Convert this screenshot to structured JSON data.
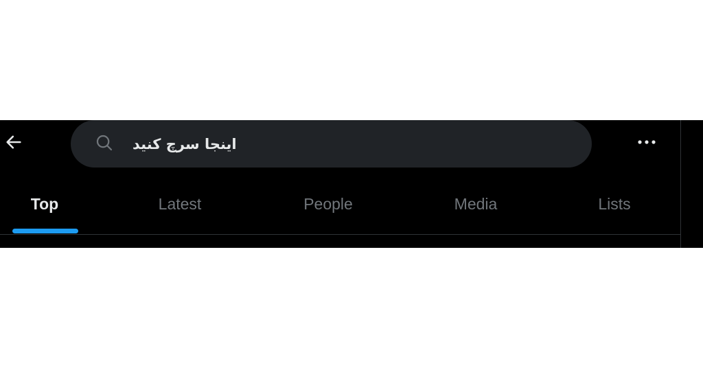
{
  "search": {
    "value": "اینجا سرچ کنید"
  },
  "tabs": [
    {
      "label": "Top",
      "active": true
    },
    {
      "label": "Latest",
      "active": false
    },
    {
      "label": "People",
      "active": false
    },
    {
      "label": "Media",
      "active": false
    },
    {
      "label": "Lists",
      "active": false
    }
  ],
  "icons": {
    "back": "arrow-left-icon",
    "search": "search-icon",
    "more": "more-horizontal-icon"
  },
  "colors": {
    "background": "#000000",
    "search_bg": "#202327",
    "accent": "#1d9bf0",
    "active_text": "#e7e9ea",
    "inactive_text": "#71767b",
    "divider": "#2f3336"
  }
}
